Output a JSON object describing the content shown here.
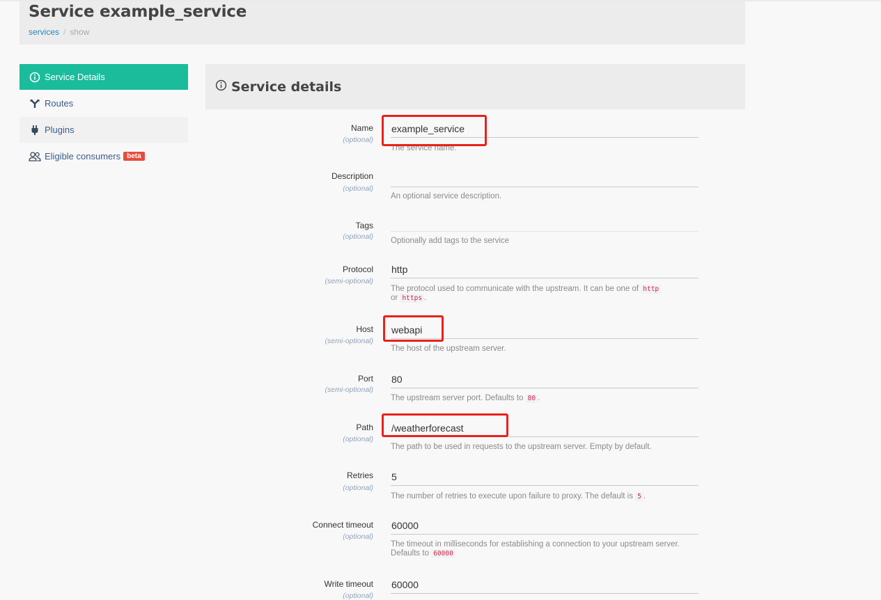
{
  "header": {
    "title": "Service example_service",
    "breadcrumb": {
      "link": "services",
      "separator": "/",
      "current": "show"
    }
  },
  "sidebar": {
    "items": [
      {
        "label": "Service Details",
        "icon": "info-circle-icon"
      },
      {
        "label": "Routes",
        "icon": "routes-icon"
      },
      {
        "label": "Plugins",
        "icon": "plug-icon"
      },
      {
        "label": "Eligible consumers",
        "icon": "users-icon",
        "badge": "beta"
      }
    ]
  },
  "panel": {
    "title": "Service details",
    "icon": "info-circle-icon"
  },
  "fields": {
    "name": {
      "label": "Name",
      "qualifier": "(optional)",
      "value": "example_service",
      "help": "The service name."
    },
    "description": {
      "label": "Description",
      "qualifier": "(optional)",
      "value": "",
      "help": "An optional service description."
    },
    "tags": {
      "label": "Tags",
      "qualifier": "(optional)",
      "value": "",
      "help": "Optionally add tags to the service"
    },
    "protocol": {
      "label": "Protocol",
      "qualifier": "(semi-optional)",
      "value": "http",
      "help_pre": "The protocol used to communicate with the upstream. It can be one of",
      "code1": "http",
      "help_mid": "or",
      "code2": "https",
      "help_post": "."
    },
    "host": {
      "label": "Host",
      "qualifier": "(semi-optional)",
      "value": "webapi",
      "help": "The host of the upstream server."
    },
    "port": {
      "label": "Port",
      "qualifier": "(semi-optional)",
      "value": "80",
      "help_pre": "The upstream server port. Defaults to",
      "code": "80",
      "help_post": "."
    },
    "path": {
      "label": "Path",
      "qualifier": "(optional)",
      "value": "/weatherforecast",
      "help": "The path to be used in requests to the upstream server. Empty by default."
    },
    "retries": {
      "label": "Retries",
      "qualifier": "(optional)",
      "value": "5",
      "help_pre": "The number of retries to execute upon failure to proxy. The default is",
      "code": "5",
      "help_post": "."
    },
    "connect_timeout": {
      "label": "Connect timeout",
      "qualifier": "(optional)",
      "value": "60000",
      "help_pre": "The timeout in milliseconds for establishing a connection to your upstream server. Defaults to",
      "code": "60000"
    },
    "write_timeout": {
      "label": "Write timeout",
      "qualifier": "(optional)",
      "value": "60000"
    }
  },
  "colors": {
    "accent": "#1abc9c",
    "highlight": "#e8211a",
    "badge": "#e74c3c",
    "link": "#1e88c7"
  }
}
